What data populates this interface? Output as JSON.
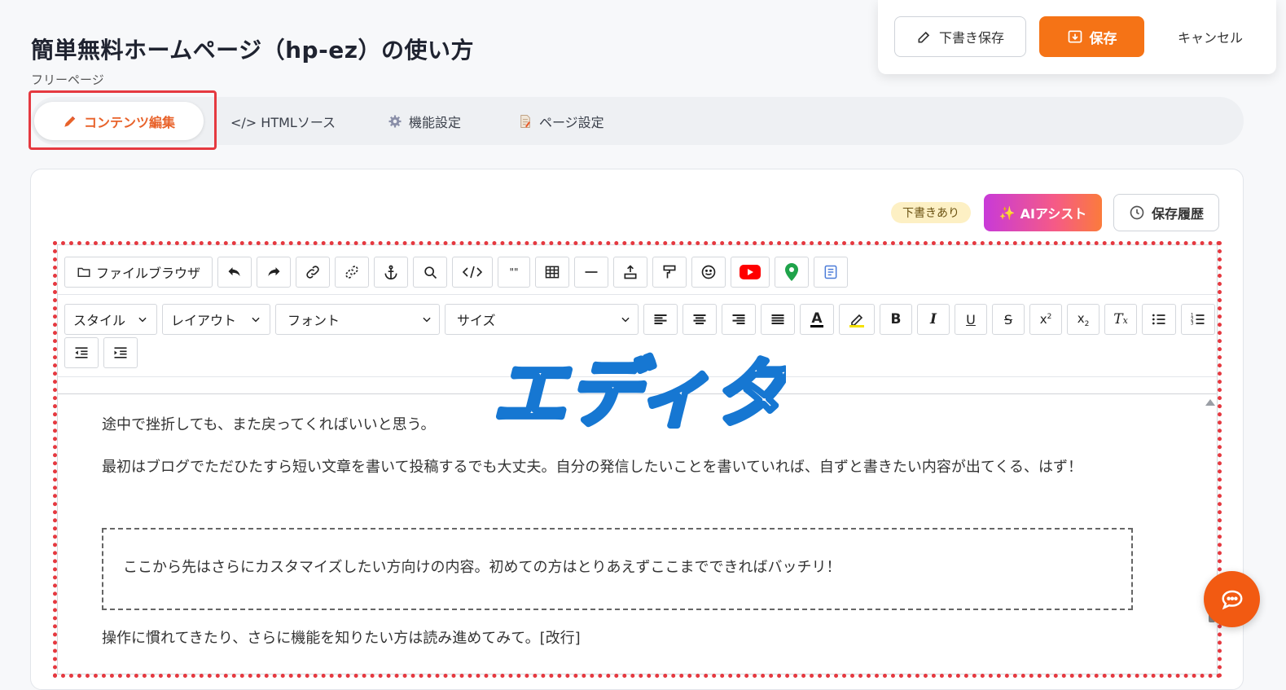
{
  "header": {
    "title": "簡単無料ホームページ（hp-ez）の使い方",
    "subtitle": "フリーページ"
  },
  "actions": {
    "draft_save": "下書き保存",
    "save": "保存",
    "cancel": "キャンセル"
  },
  "tabs": [
    {
      "label": "コンテンツ編集",
      "active": true
    },
    {
      "label": "</> HTMLソース"
    },
    {
      "label": "機能設定"
    },
    {
      "label": "ページ設定"
    }
  ],
  "editor_header": {
    "draft_badge": "下書きあり",
    "ai_assist": "AIアシスト",
    "history": "保存履歴"
  },
  "toolbar": {
    "file_browser": "ファイルブラウザ",
    "style": "スタイル",
    "layout": "レイアウト",
    "font": "フォント",
    "size": "サイズ",
    "quote": "\"\""
  },
  "content": {
    "p1": "途中で挫折しても、また戻ってくればいいと思う。",
    "p2": "最初はブログでただひたすら短い文章を書いて投稿するでも大丈夫。自分の発信したいことを書いていれば、自ずと書きたい内容が出てくる、はず！",
    "box": "ここから先はさらにカスタマイズしたい方向けの内容。初めての方はとりあえずここまでできればバッチリ！",
    "p3": "操作に慣れてきたり、さらに機能を知りたい方は読み進めてみて。[改行]"
  },
  "annotation": "エディタ",
  "colors": {
    "accent_orange": "#f57316",
    "highlight_red": "#e53940",
    "annotation_blue": "#1677d2",
    "active_tab_text": "#e8622a"
  }
}
